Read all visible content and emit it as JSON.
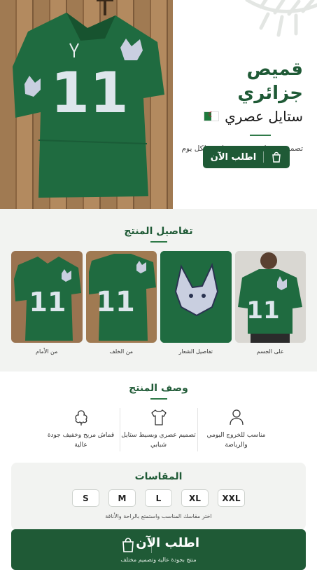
{
  "hero": {
    "title": "قميص جزائري",
    "subtitle": "ستايل عصري",
    "features": "تصميم بسيط • مريح • مناسب لكل يوم",
    "cta_label": "اطلب الآن",
    "jersey_number": "11"
  },
  "details": {
    "title": "تفاصيل المنتج",
    "thumbs": [
      {
        "caption": "على الجسم"
      },
      {
        "caption": "تفاصيل الشعار"
      },
      {
        "caption": "من الخلف"
      },
      {
        "caption": "من الأمام"
      }
    ]
  },
  "description": {
    "title": "وصف المنتج",
    "items": [
      {
        "text": "مناسب للخروج اليومي والرياضة",
        "icon": "person-icon"
      },
      {
        "text": "تصميم عصري وبسيط ستايل شبابي",
        "icon": "tshirt-icon"
      },
      {
        "text": "قماش مريح وخفيف جودة عالية",
        "icon": "cotton-icon"
      }
    ]
  },
  "sizes": {
    "title": "المقاسات",
    "options": [
      "S",
      "M",
      "L",
      "XL",
      "XXL"
    ],
    "hint": "اختر مقاسك المناسب واستمتع بالراحة والأناقة"
  },
  "cta": {
    "label": "اطلب الآن",
    "sub": "منتج بجودة عالية وتصميم مختلف"
  },
  "colors": {
    "brand_green": "#1f5a36",
    "jersey_green": "#1f6b40"
  }
}
